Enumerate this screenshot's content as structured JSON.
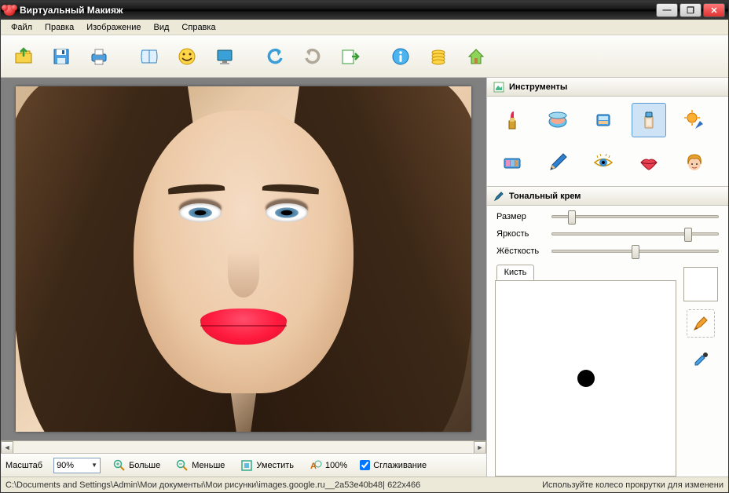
{
  "window": {
    "title": "Виртуальный Макияж"
  },
  "menu": {
    "items": [
      "Файл",
      "Правка",
      "Изображение",
      "Вид",
      "Справка"
    ]
  },
  "toolbar": {
    "items": [
      {
        "name": "open",
        "title": "Открыть"
      },
      {
        "name": "save",
        "title": "Сохранить"
      },
      {
        "name": "print",
        "title": "Печать"
      },
      {
        "sep": true
      },
      {
        "name": "album",
        "title": "Альбом"
      },
      {
        "name": "smile",
        "title": "Смайл"
      },
      {
        "name": "screen",
        "title": "Экран"
      },
      {
        "sep": true
      },
      {
        "name": "undo",
        "title": "Отменить"
      },
      {
        "name": "redo",
        "title": "Повторить"
      },
      {
        "name": "apply",
        "title": "Применить"
      },
      {
        "sep": true
      },
      {
        "name": "info",
        "title": "Инфо"
      },
      {
        "name": "coins",
        "title": "Купить"
      },
      {
        "name": "home",
        "title": "Домой"
      }
    ]
  },
  "zoombar": {
    "scale_label": "Масштаб",
    "scale_value": "90%",
    "more": "Больше",
    "less": "Меньше",
    "fit": "Уместить",
    "hundred": "100%",
    "smoothing": "Сглаживание",
    "smoothing_checked": true
  },
  "side": {
    "tools_title": "Инструменты",
    "tools": [
      {
        "name": "lipstick",
        "label": "Губная помада"
      },
      {
        "name": "blush",
        "label": "Румяна"
      },
      {
        "name": "powder",
        "label": "Пудра"
      },
      {
        "name": "foundation",
        "label": "Тональный крем",
        "selected": true
      },
      {
        "name": "sun",
        "label": "Загар"
      },
      {
        "name": "eyeshadow",
        "label": "Тени"
      },
      {
        "name": "pencil",
        "label": "Карандаш"
      },
      {
        "name": "eye",
        "label": "Глаза"
      },
      {
        "name": "lips",
        "label": "Губы"
      },
      {
        "name": "hair",
        "label": "Волосы"
      }
    ],
    "props_title": "Тональный крем",
    "sliders": {
      "size": {
        "label": "Размер",
        "value": 12
      },
      "bright": {
        "label": "Яркость",
        "value": 82
      },
      "hard": {
        "label": "Жёсткость",
        "value": 50
      }
    },
    "brush_tab": "Кисть",
    "color_hex": "#ffffff"
  },
  "status": {
    "left": "C:\\Documents and Settings\\Admin\\Мои документы\\Мои рисунки\\images.google.ru__2a53e40b48| 622x466",
    "right": "Используйте колесо прокрутки для изменени"
  }
}
